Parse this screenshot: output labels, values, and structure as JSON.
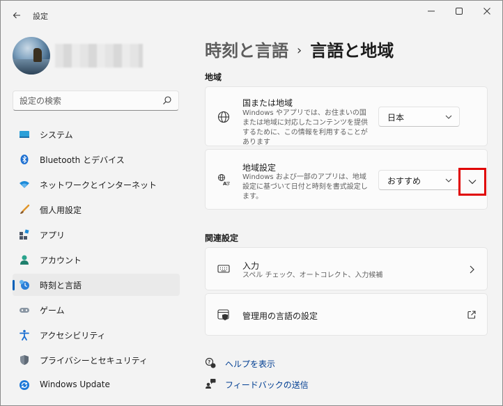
{
  "window": {
    "back_icon": "back-arrow-icon",
    "title": "設定",
    "controls": [
      "minimize",
      "maximize",
      "close"
    ]
  },
  "sidebar": {
    "search_placeholder": "設定の検索",
    "items": [
      {
        "label": "システム",
        "icon": "system-icon",
        "active": false
      },
      {
        "label": "Bluetooth とデバイス",
        "icon": "bluetooth-icon",
        "active": false
      },
      {
        "label": "ネットワークとインターネット",
        "icon": "network-icon",
        "active": false
      },
      {
        "label": "個人用設定",
        "icon": "personalization-brush-icon",
        "active": false
      },
      {
        "label": "アプリ",
        "icon": "apps-icon",
        "active": false
      },
      {
        "label": "アカウント",
        "icon": "account-icon",
        "active": false
      },
      {
        "label": "時刻と言語",
        "icon": "time-language-icon",
        "active": true
      },
      {
        "label": "ゲーム",
        "icon": "gaming-icon",
        "active": false
      },
      {
        "label": "アクセシビリティ",
        "icon": "accessibility-icon",
        "active": false
      },
      {
        "label": "プライバシーとセキュリティ",
        "icon": "shield-icon",
        "active": false
      },
      {
        "label": "Windows Update",
        "icon": "windows-update-icon",
        "active": false
      }
    ]
  },
  "main": {
    "breadcrumb": {
      "parent": "時刻と言語",
      "separator": "›",
      "current": "言語と地域"
    },
    "region_section": {
      "title": "地域",
      "country": {
        "title": "国または地域",
        "description": "Windows やアプリでは、お住まいの国または地域に対応したコンテンツを提供するために、この情報を利用することがあります",
        "value": "日本"
      },
      "regional_format": {
        "title": "地域設定",
        "description": "Windows および一部のアプリは、地域設定に基づいて日付と時刻を書式設定します。",
        "value": "おすすめ"
      }
    },
    "related_section": {
      "title": "関連設定",
      "typing": {
        "title": "入力",
        "description": "スペル チェック、オートコレクト、入力候補"
      },
      "admin_language": {
        "title": "管理用の言語の設定"
      }
    },
    "links": {
      "help": "ヘルプを表示",
      "feedback": "フィードバックの送信"
    }
  },
  "colors": {
    "accent": "#005fb8",
    "highlight_box": "#e00000"
  }
}
